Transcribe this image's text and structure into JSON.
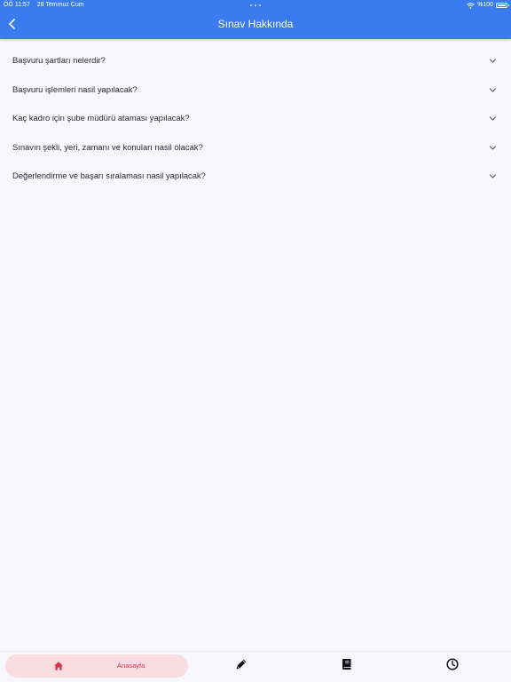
{
  "status_bar": {
    "time": "ÖĞ 11:57",
    "date": "28 Temmuz Cum",
    "battery": "%100"
  },
  "header": {
    "title": "Sınav Hakkında",
    "back_icon": "chevron-left-icon"
  },
  "faq": {
    "items": [
      {
        "question": "Başvuru şartları nelerdir?"
      },
      {
        "question": "Başvuru işlemleri nasil yapılacak?"
      },
      {
        "question": "Kaç kadro için şube müdürü ataması yapılacak?"
      },
      {
        "question": "Sınavın şekli, yeri, zamanı ve konuları nasil olacak?"
      },
      {
        "question": "Değerlendirme ve başarı sıralaması nasil yapılacak?"
      }
    ],
    "chevron_icon": "chevron-down-icon"
  },
  "bottom_nav": {
    "home_label": "Anasayfa",
    "items": [
      "home-icon",
      "pencil-icon",
      "book-icon",
      "clock-icon"
    ]
  },
  "colors": {
    "header_bg": "#3a7bf0",
    "accent_active": "#d8354f",
    "active_pill": "#f9dbe2",
    "background": "#f8f8fc"
  }
}
